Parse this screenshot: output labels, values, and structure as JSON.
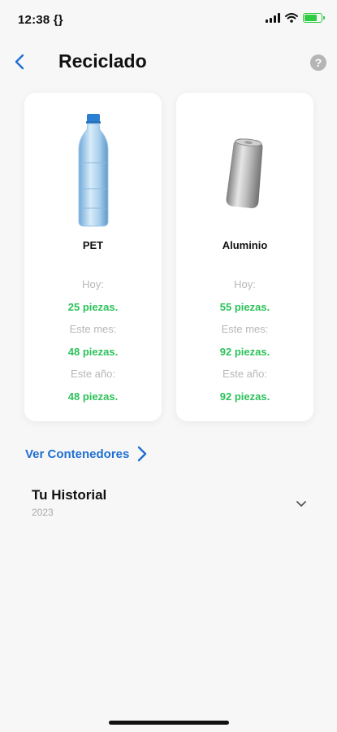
{
  "status_bar": {
    "time": "12:38 {}",
    "icons": [
      "signal-icon",
      "wifi-icon",
      "battery-charging-icon"
    ]
  },
  "header": {
    "back_icon": "chevron-left-icon",
    "title": "Reciclado",
    "help_icon": "question-mark-icon",
    "help_glyph": "?"
  },
  "cards": [
    {
      "name": "PET",
      "image": "plastic-bottle-image",
      "today_label": "Hoy:",
      "today_value": "25 piezas.",
      "month_label": "Este mes:",
      "month_value": "48 piezas.",
      "year_label": "Este año:",
      "year_value": "48 piezas."
    },
    {
      "name": "Aluminio",
      "image": "aluminum-can-image",
      "today_label": "Hoy:",
      "today_value": "55 piezas.",
      "month_label": "Este mes:",
      "month_value": "92 piezas.",
      "year_label": "Este año:",
      "year_value": "92 piezas."
    }
  ],
  "containers_link": {
    "label": "Ver Contenedores",
    "icon": "chevron-right-icon"
  },
  "history": {
    "title": "Tu Historial",
    "year": "2023",
    "toggle_icon": "chevron-down-icon"
  },
  "colors": {
    "accent_blue": "#1f6fd1",
    "value_green": "#2cc25a",
    "label_gray": "#b7b7b7",
    "background": "#f7f7f8"
  }
}
